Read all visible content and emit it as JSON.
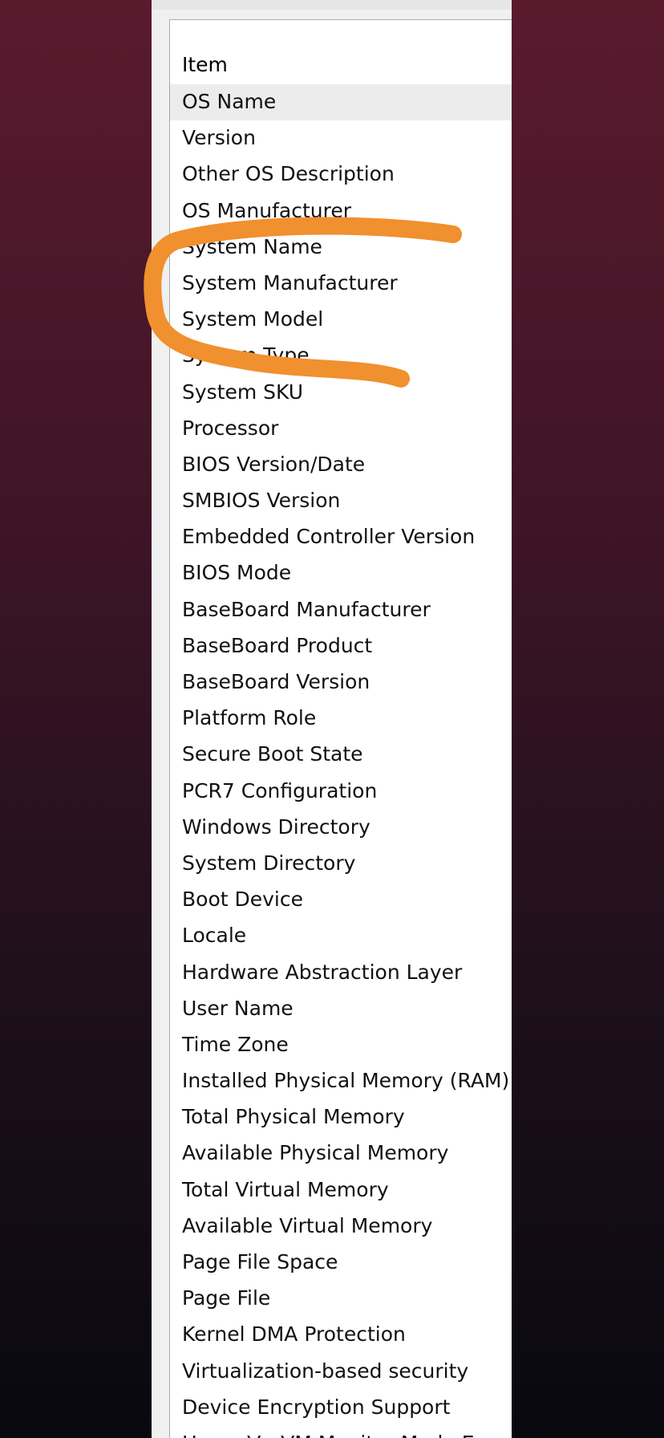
{
  "list": {
    "column_header": "Item",
    "selected_index": 0,
    "items": [
      "OS Name",
      "Version",
      "Other OS Description",
      "OS Manufacturer",
      "System Name",
      "System Manufacturer",
      "System Model",
      "System Type",
      "System SKU",
      "Processor",
      "BIOS Version/Date",
      "SMBIOS Version",
      "Embedded Controller Version",
      "BIOS Mode",
      "BaseBoard Manufacturer",
      "BaseBoard Product",
      "BaseBoard Version",
      "Platform Role",
      "Secure Boot State",
      "PCR7 Configuration",
      "Windows Directory",
      "System Directory",
      "Boot Device",
      "Locale",
      "Hardware Abstraction Layer",
      "User Name",
      "Time Zone",
      "Installed Physical Memory (RAM)",
      "Total Physical Memory",
      "Available Physical Memory",
      "Total Virtual Memory",
      "Available Virtual Memory",
      "Page File Space",
      "Page File",
      "Kernel DMA Protection",
      "Virtualization-based security",
      "Device Encryption Support",
      "Hyper-V - VM Monitor Mode E"
    ]
  },
  "annotation": {
    "color": "#f0902e"
  }
}
